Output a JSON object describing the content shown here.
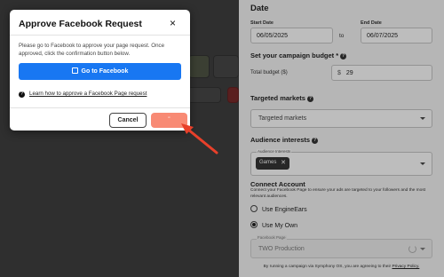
{
  "modal": {
    "title": "Approve Facebook Request",
    "close_icon": "×",
    "body": "Please go to Facebook to approve your page request. Once approved, click the confirmation button below.",
    "go_button": "Go to Facebook",
    "help_icon": "?",
    "help_link": "Learn how to approve a Facebook Page request",
    "cancel_button": "Cancel",
    "confirm_button": "\""
  },
  "form": {
    "date": {
      "title": "Date",
      "start_label": "Start Date",
      "start_value": "06/05/2025",
      "to_label": "to",
      "end_label": "End Date",
      "end_value": "06/07/2025"
    },
    "budget": {
      "title": "Set your campaign budget *",
      "total_label": "Total budget ($)",
      "currency": "$",
      "value": "29"
    },
    "markets": {
      "title": "Targeted markets",
      "placeholder": "Targeted markets"
    },
    "interests": {
      "title": "Audience interests",
      "field_label": "Audience Interests",
      "chip": "Games",
      "chip_remove": "✕"
    },
    "connect": {
      "title": "Connect Account",
      "description": "Connect your Facebook Page to ensure your ads are targeted to your followers and the most relevant audiences.",
      "option1": "Use EngineEars",
      "option2": "Use My Own",
      "page_label": "Facebook Page",
      "page_value": "TWO Production"
    },
    "footer_text": "By running a campaign via Symphony OS, you are agreeing to their",
    "footer_link": "Privacy Policy."
  },
  "colors": {
    "facebook_blue": "#1877f2",
    "confirm_salmon": "#f88a74",
    "arrow_red": "#e8402a"
  }
}
